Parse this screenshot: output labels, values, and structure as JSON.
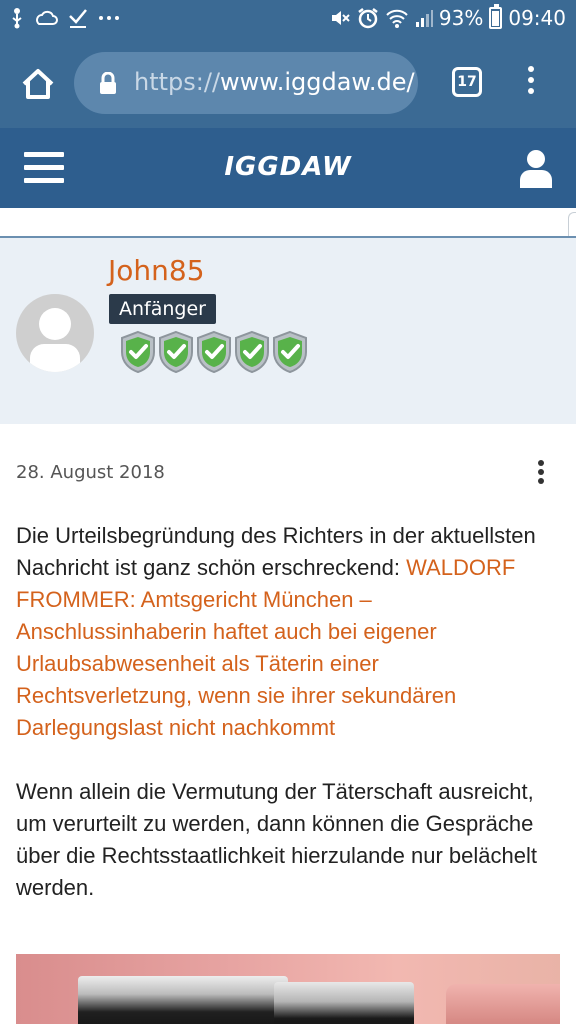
{
  "status_bar": {
    "battery": "93%",
    "time": "09:40",
    "battery_level": 0.93,
    "icons_left": [
      "usb-debug-icon",
      "cloud-icon",
      "check-icon",
      "more-notifications-icon"
    ],
    "icons_right": [
      "mute-icon",
      "alarm-icon",
      "wifi-icon",
      "signal-icon",
      "battery-icon"
    ]
  },
  "browser": {
    "url_protocol": "https://",
    "url_host": "www.iggdaw.de/",
    "tab_count": "17"
  },
  "site": {
    "title": "IGGDAW"
  },
  "post": {
    "author": "John85",
    "rank": "Anfänger",
    "rank_level": 5,
    "date": "28. August 2018",
    "paragraph1_text": "Die Urteilsbegründung des Richters in der aktuellsten Nachricht ist ganz schön erschreckend:",
    "paragraph1_link": "WALDORF FROMMER: Amtsgericht München – Anschlussinhaberin haftet auch bei eigener Urlaubsabwesenheit als Täterin einer Rechtsverletzung, wenn sie ihrer sekundären Darlegungslast nicht nachkommt",
    "paragraph2": "Wenn allein die Vermutung der Täterschaft ausreicht, um verurteilt zu werden, dann können die Gespräche über die Rechtsstaatlichkeit hierzulande nur belächelt werden."
  },
  "colors": {
    "header_blue": "#2e5e8e",
    "browser_blue": "#3b6a94",
    "accent_orange": "#d4621c",
    "panel_bg": "#eaf0f6"
  }
}
